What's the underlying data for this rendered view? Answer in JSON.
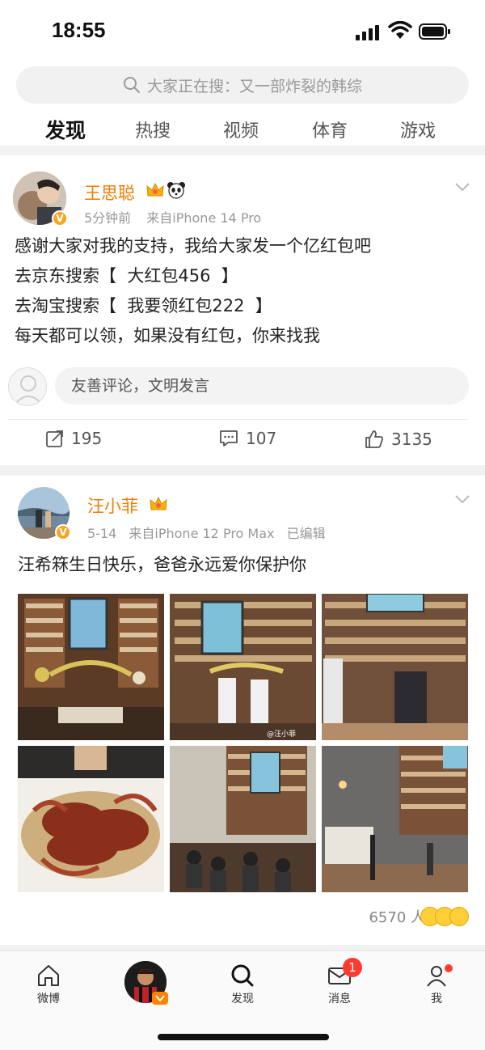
{
  "status_bar": {
    "time": "18:55"
  },
  "search": {
    "placeholder": "大家正在搜：又一部炸裂的韩综"
  },
  "tabs": [
    {
      "label": "发现",
      "active": true
    },
    {
      "label": "热搜",
      "active": false
    },
    {
      "label": "视频",
      "active": false
    },
    {
      "label": "体育",
      "active": false
    },
    {
      "label": "游戏",
      "active": false
    }
  ],
  "post1": {
    "username": "王思聪",
    "time": "5分钟前",
    "source": "来自iPhone 14 Pro",
    "lines": [
      "感谢大家对我的支持，我给大家发一个亿红包吧",
      "去京东搜索【  大红包456  】",
      "去淘宝搜索【  我要领红包222  】",
      "每天都可以领，如果没有红包，你来找我"
    ],
    "comment_placeholder": "友善评论，文明发言",
    "reposts": "195",
    "comments": "107",
    "likes": "3135"
  },
  "post2": {
    "username": "汪小菲",
    "date": "5-14",
    "source": "来自iPhone 12 Pro Max",
    "edited": "已编辑",
    "text": "汪希箖生日快乐，爸爸永远爱你保护你",
    "reaction_count": "6570 人",
    "photo_watermark": "@汪小菲"
  },
  "bottom_nav": {
    "home": "微博",
    "discover": "发现",
    "messages": "消息",
    "messages_badge": "1",
    "me": "我"
  },
  "colors": {
    "username": "#f07c00",
    "accent": "#ff8200",
    "badge": "#ff3b30"
  }
}
